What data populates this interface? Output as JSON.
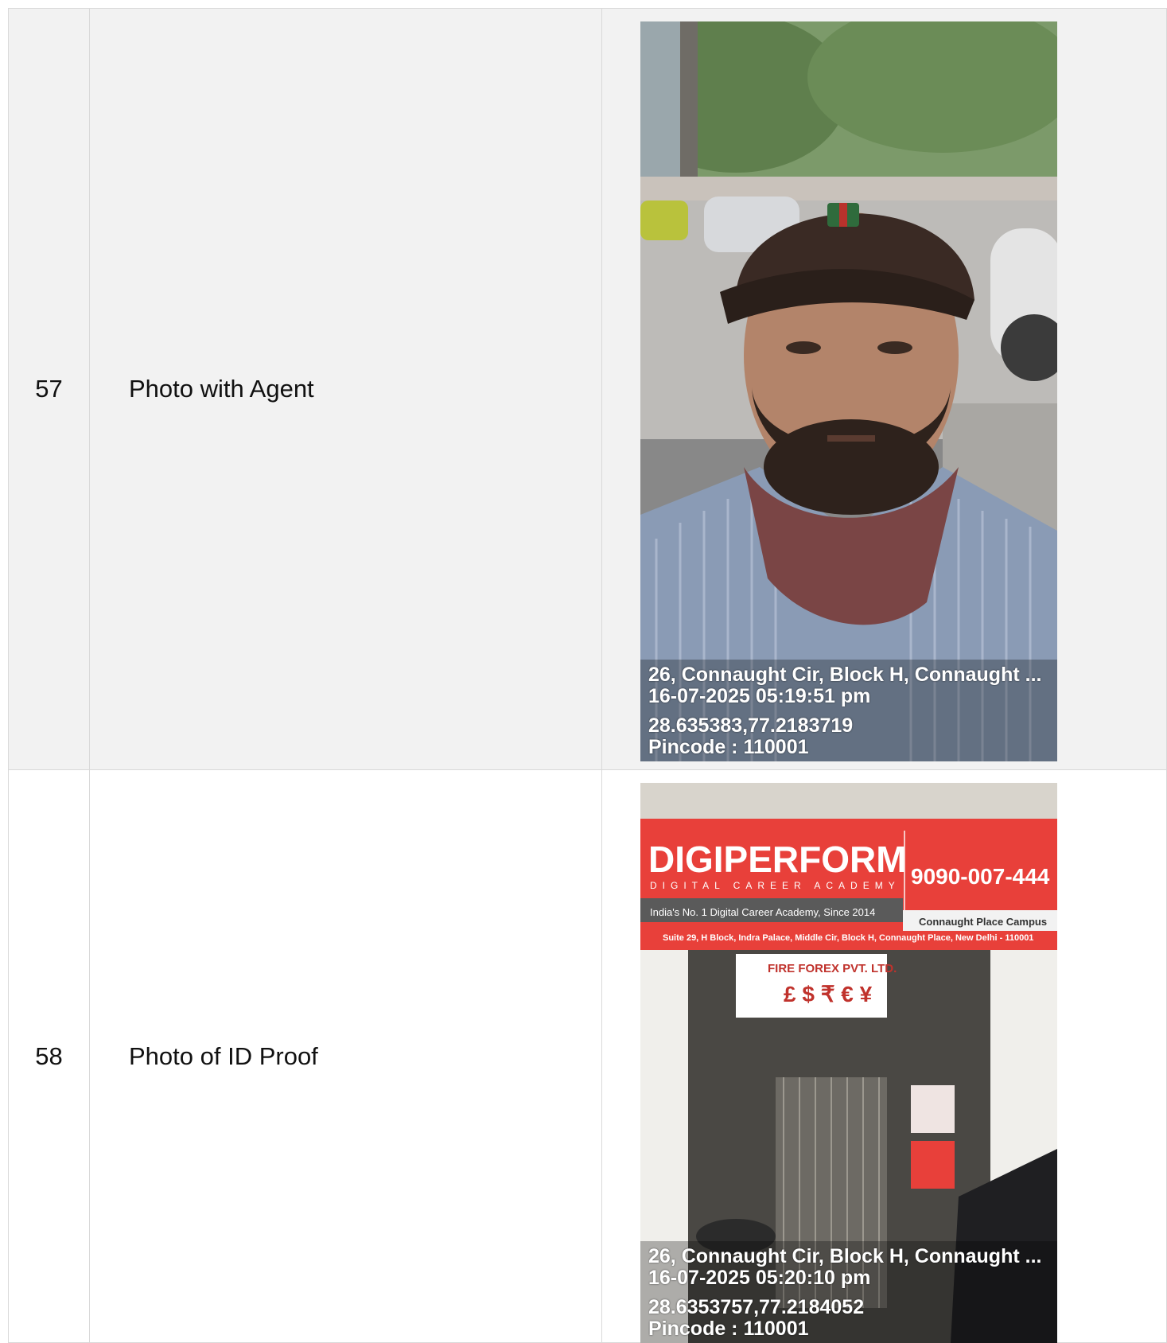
{
  "rows": [
    {
      "number": "57",
      "label": "Photo with Agent",
      "photo": {
        "subject": "selfie of man in brown cap and striped shirt on street",
        "overlay": {
          "address": "26, Connaught Cir, Block H, Connaught ...",
          "datetime": "16-07-2025 05:19:51 pm",
          "coords": "28.635383,77.2183719",
          "pincode": "Pincode : 110001"
        }
      }
    },
    {
      "number": "58",
      "label": "Photo of ID Proof",
      "photo": {
        "subject": "storefront with red signboard",
        "sign": {
          "brand": "DIGIPERFORM",
          "tagline": "DIGITAL CAREER ACADEMY",
          "phone": "9090-007-444",
          "slogan": "India's No. 1 Digital Career Academy, Since 2014",
          "campus": "Connaught Place Campus",
          "address": "Suite 29, H Block, Indra Palace, Middle Cir, Block H, Connaught Place, New Delhi - 110001",
          "forex": "FIRE FOREX PVT. LTD."
        },
        "overlay": {
          "address": "26, Connaught Cir, Block H, Connaught ...",
          "datetime": "16-07-2025 05:20:10 pm",
          "coords": "28.6353757,77.2184052",
          "pincode": "Pincode : 110001"
        }
      }
    }
  ],
  "colors": {
    "row_alt_bg": "#f2f2f2",
    "border": "#d9d9d9",
    "sign_red": "#e8403a"
  }
}
